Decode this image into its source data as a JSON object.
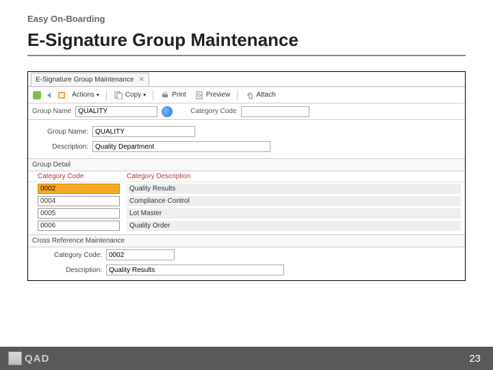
{
  "slide": {
    "eyebrow": "Easy On-Boarding",
    "title": "E-Signature Group Maintenance"
  },
  "tab": {
    "label": "E-Signature Group Maintenance"
  },
  "toolbar": {
    "actions": "Actions",
    "copy": "Copy",
    "print": "Print",
    "preview": "Preview",
    "attach": "Attach"
  },
  "search": {
    "group_name_label": "Group Name",
    "group_name_value": "QUALITY",
    "category_code_label": "Category Code"
  },
  "form": {
    "group_name_label": "Group Name:",
    "group_name_value": "QUALITY",
    "description_label": "Description:",
    "description_value": "Quality Department"
  },
  "group_detail": {
    "header": "Group Detail",
    "colA": "Category Code",
    "colB": "Category Description",
    "rows": [
      {
        "code": "0002",
        "desc": "Quality Results",
        "selected": true
      },
      {
        "code": "0004",
        "desc": "Compliance Control",
        "selected": false
      },
      {
        "code": "0005",
        "desc": "Lot Master",
        "selected": false
      },
      {
        "code": "0006",
        "desc": "Quality Order",
        "selected": false
      }
    ]
  },
  "xref": {
    "header": "Cross Reference Maintenance",
    "category_code_label": "Category Code:",
    "category_code_value": "0002",
    "description_label": "Description:",
    "description_value": "Quality Results"
  },
  "footer": {
    "brand": "QAD",
    "page": "23"
  }
}
